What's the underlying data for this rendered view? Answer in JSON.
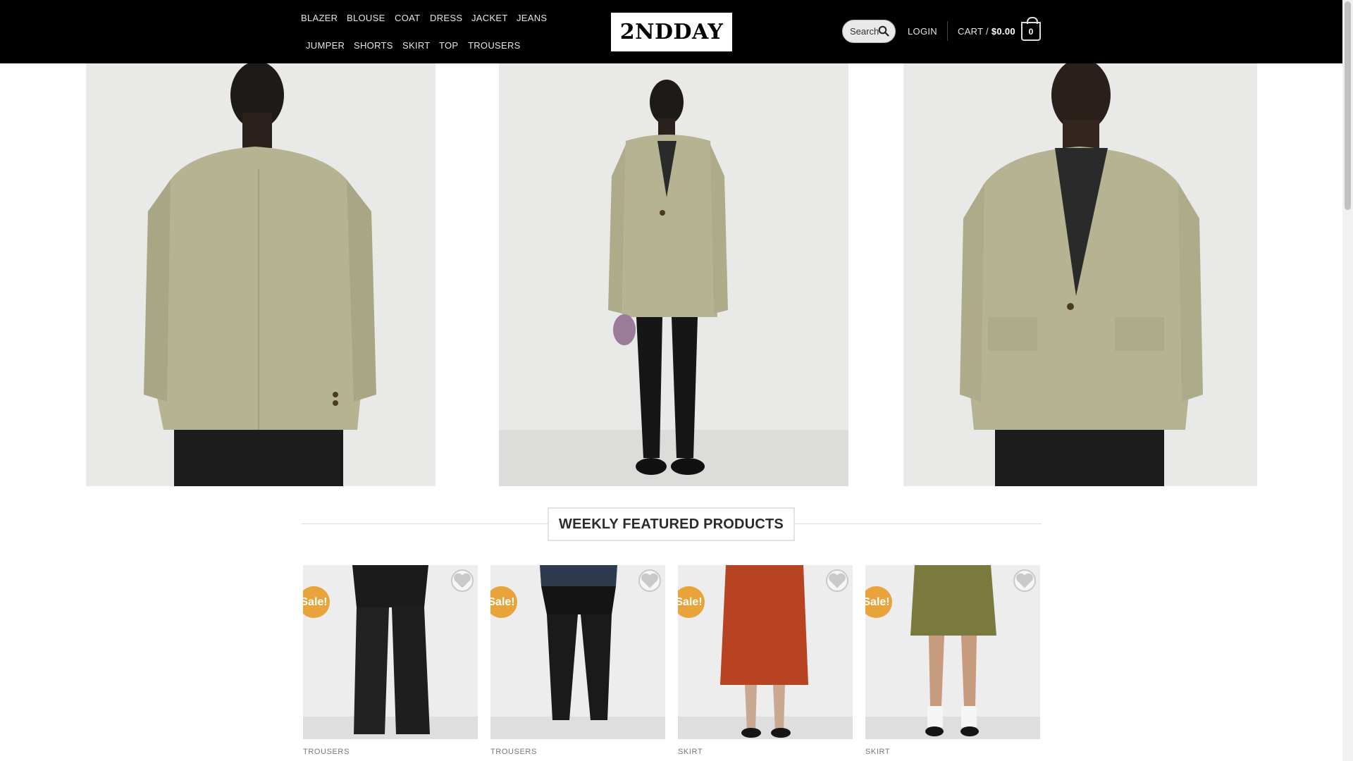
{
  "header": {
    "nav_row1": [
      "BLAZER",
      "BLOUSE",
      "COAT",
      "DRESS",
      "JACKET",
      "JEANS"
    ],
    "nav_row2": [
      "JUMPER",
      "SHORTS",
      "SKIRT",
      "TOP",
      "TROUSERS"
    ],
    "logo_text": "2NDDAY",
    "search_placeholder": "Search",
    "login_label": "LOGIN",
    "cart_label": "CART /",
    "cart_total": "$0.00",
    "cart_count": "0"
  },
  "section": {
    "title": "WEEKLY FEATURED PRODUCTS"
  },
  "products": [
    {
      "category": "TROUSERS",
      "badge": "Sale!",
      "image": "black wide-leg trousers"
    },
    {
      "category": "TROUSERS",
      "badge": "Sale!",
      "image": "black leather trousers"
    },
    {
      "category": "SKIRT",
      "badge": "Sale!",
      "image": "rust leather midi skirt"
    },
    {
      "category": "SKIRT",
      "badge": "Sale!",
      "image": "olive leather mini skirt"
    }
  ],
  "colors": {
    "header_bg": "#000000",
    "sale_badge": "#e8a33b",
    "blazer": "#b6b392",
    "hero_bg": "#e8e8e6"
  }
}
